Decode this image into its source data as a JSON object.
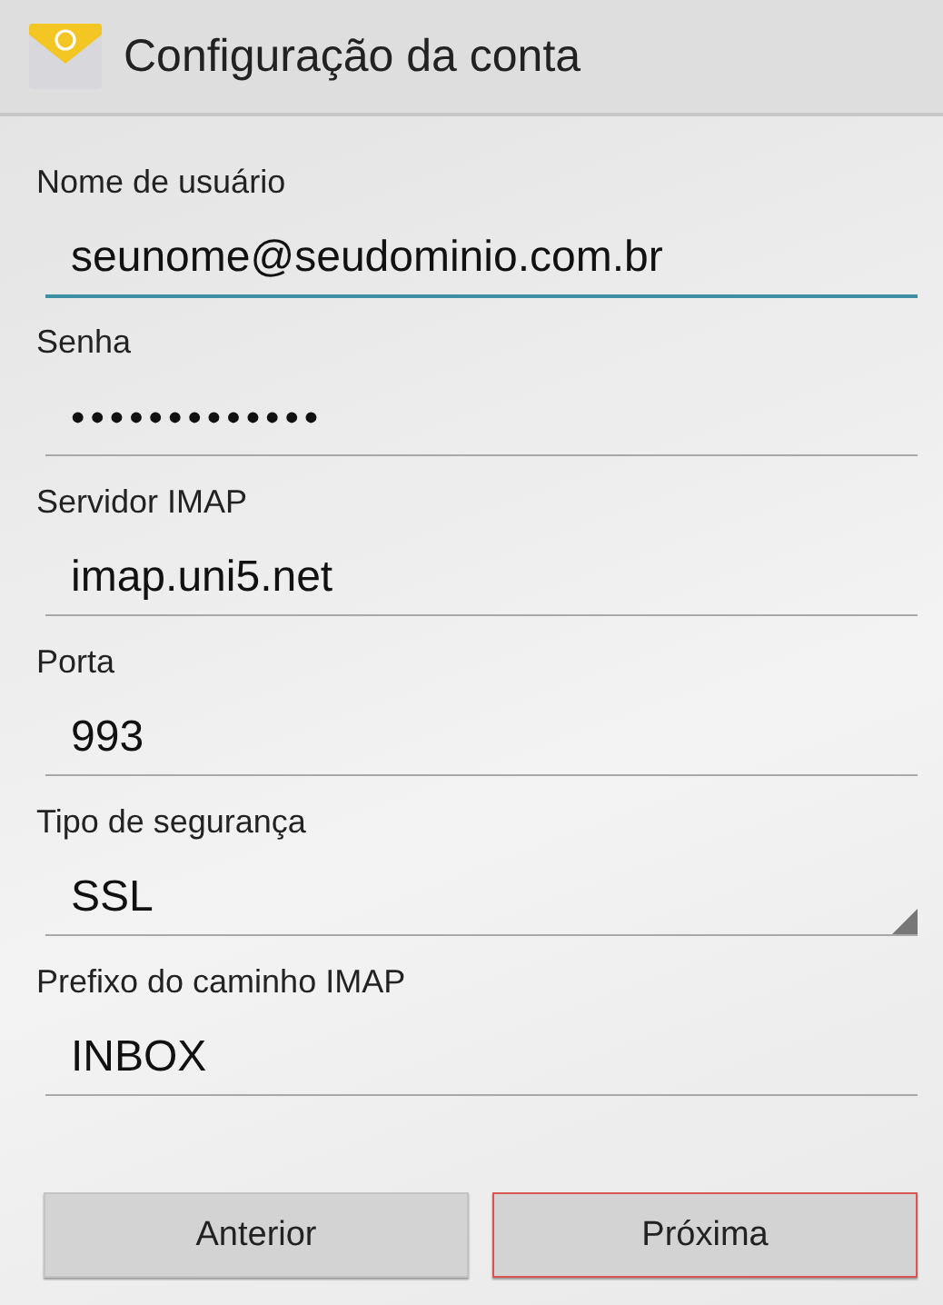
{
  "header": {
    "title": "Configuração da conta"
  },
  "fields": [
    {
      "label": "Nome de usuário",
      "kind": "text",
      "value": "seunome@seudominio.com.br",
      "focused": true
    },
    {
      "label": "Senha",
      "kind": "password",
      "value": "•••••••••••••",
      "focused": false
    },
    {
      "label": "Servidor IMAP",
      "kind": "text",
      "value": "imap.uni5.net",
      "focused": false
    },
    {
      "label": "Porta",
      "kind": "text",
      "value": "993",
      "focused": false
    },
    {
      "label": "Tipo de segurança",
      "kind": "select",
      "value": "SSL",
      "focused": false
    },
    {
      "label": "Prefixo do caminho IMAP",
      "kind": "text",
      "value": "INBOX",
      "focused": false
    }
  ],
  "buttons": [
    {
      "label": "Anterior",
      "highlighted": false
    },
    {
      "label": "Próxima",
      "highlighted": true
    }
  ]
}
